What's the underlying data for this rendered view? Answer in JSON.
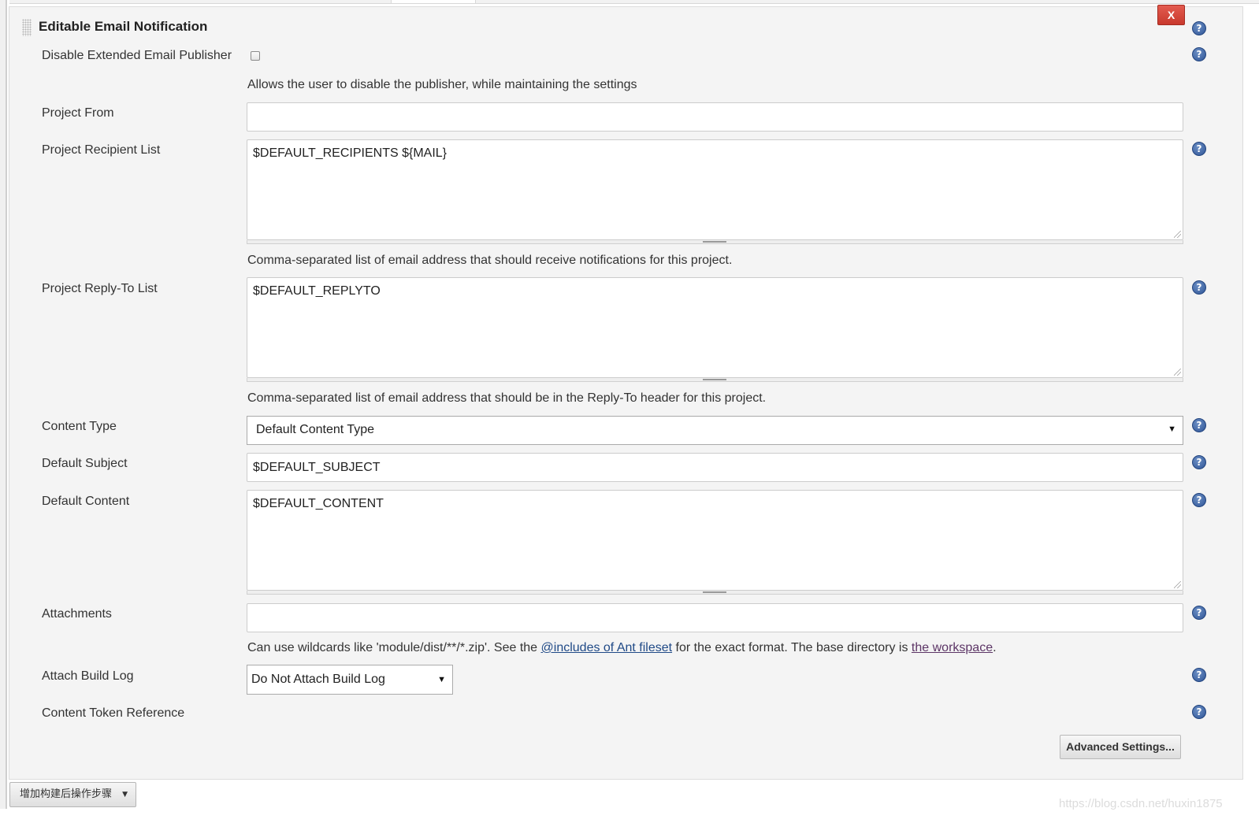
{
  "section": {
    "title": "Editable Email Notification",
    "close_label": "X",
    "help_glyph": "?"
  },
  "disable_publisher": {
    "label": "Disable Extended Email Publisher",
    "checked": false,
    "description": "Allows the user to disable the publisher, while maintaining the settings"
  },
  "project_from": {
    "label": "Project From",
    "value": ""
  },
  "recipient_list": {
    "label": "Project Recipient List",
    "value": "$DEFAULT_RECIPIENTS ${MAIL}",
    "description": "Comma-separated list of email address that should receive notifications for this project."
  },
  "reply_to_list": {
    "label": "Project Reply-To List",
    "value": "$DEFAULT_REPLYTO",
    "description": "Comma-separated list of email address that should be in the Reply-To header for this project."
  },
  "content_type": {
    "label": "Content Type",
    "selected": "Default Content Type"
  },
  "default_subject": {
    "label": "Default Subject",
    "value": "$DEFAULT_SUBJECT"
  },
  "default_content": {
    "label": "Default Content",
    "value": "$DEFAULT_CONTENT"
  },
  "attachments": {
    "label": "Attachments",
    "value": "",
    "desc_part1": "Can use wildcards like 'module/dist/**/*.zip'. See the ",
    "link_ant": "@includes of Ant fileset",
    "desc_part2": " for the exact format. The base directory is ",
    "link_workspace": "the workspace",
    "desc_part3": "."
  },
  "attach_build_log": {
    "label": "Attach Build Log",
    "selected": "Do Not Attach Build Log"
  },
  "content_token": {
    "label": "Content Token Reference"
  },
  "advanced_button": "Advanced Settings...",
  "add_post_build_step": "增加构建后操作步骤",
  "watermark": "https://blog.csdn.net/huxin1875",
  "icons": {
    "help": "help-question-circle-icon",
    "caret": "caret-down-icon",
    "grip": "resize-grip-icon"
  },
  "colors": {
    "close_button": "#d0453a",
    "help_icon": "#2f5597",
    "link": "#204a87",
    "link_visited": "#5c3566",
    "section_background": "#f4f4f4"
  }
}
